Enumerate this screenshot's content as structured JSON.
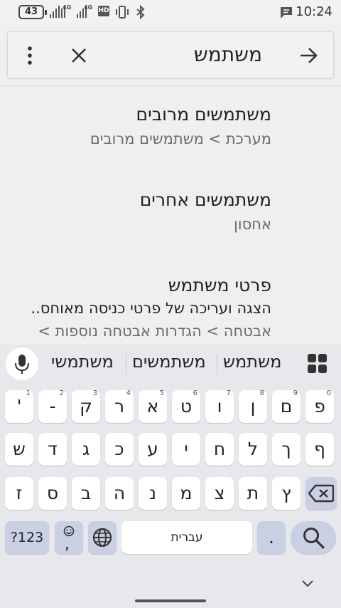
{
  "status_bar": {
    "battery": "43",
    "network_label_1": "4G",
    "network_label_2": "4G",
    "hd_label": "HD",
    "time": "10:24"
  },
  "search": {
    "query": "משתמש"
  },
  "results": [
    {
      "title": "משתמשים מרובים",
      "subtitle": "מערכת > משתמשים מרובים"
    },
    {
      "title": "משתמשים אחרים",
      "subtitle": "אחסון"
    },
    {
      "title": "פרטי משתמש",
      "description": "הצגה ועריכה של פרטי כניסה מאוחס..",
      "subtitle": "אבטחה > הגדרות אבטחה נוספות >"
    }
  ],
  "keyboard": {
    "suggestions": [
      "משתמש",
      "משתמשים",
      "משתמשי"
    ],
    "row1": [
      {
        "char": "'",
        "hint": "1"
      },
      {
        "char": "-",
        "hint": "2"
      },
      {
        "char": "ק",
        "hint": "3"
      },
      {
        "char": "ר",
        "hint": "4"
      },
      {
        "char": "א",
        "hint": "5"
      },
      {
        "char": "ט",
        "hint": "6"
      },
      {
        "char": "ו",
        "hint": "7"
      },
      {
        "char": "ן",
        "hint": "8"
      },
      {
        "char": "ם",
        "hint": "9"
      },
      {
        "char": "פ",
        "hint": "0"
      }
    ],
    "row2": [
      "ש",
      "ד",
      "ג",
      "כ",
      "ע",
      "י",
      "ח",
      "ל",
      "ך",
      "ף"
    ],
    "row3": [
      "ז",
      "ס",
      "ב",
      "ה",
      "נ",
      "מ",
      "צ",
      "ת",
      "ץ"
    ],
    "symbols_label": "?123",
    "emoji_comma": ",",
    "space_label": "עברית",
    "period_label": "."
  },
  "colors": {
    "background": "#efefef",
    "keyboard_bg": "#e6e8ec",
    "key_accent": "#c9d0e3"
  }
}
